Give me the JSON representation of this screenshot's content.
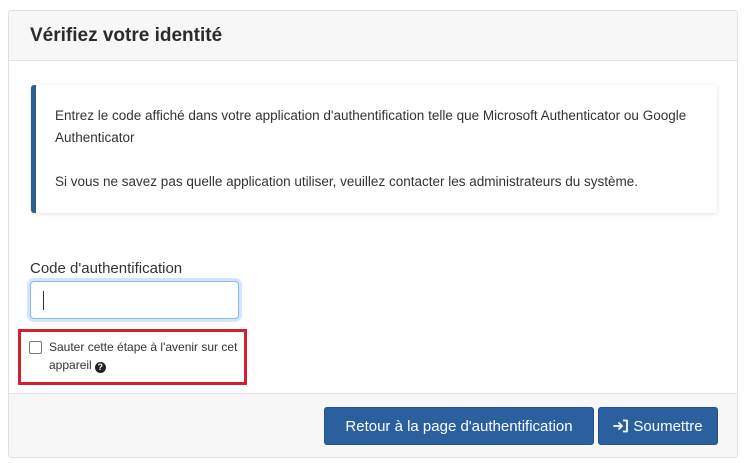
{
  "card": {
    "title": "Vérifiez votre identité"
  },
  "info": {
    "line1": "Entrez le code affiché dans votre application d'authentification telle que Microsoft Authenticator ou Google Authenticator",
    "line2": "Si vous ne savez pas quelle application utiliser, veuillez contacter les administrateurs du système."
  },
  "form": {
    "code_label": "Code d'authentification",
    "code_value": "",
    "skip_label": "Sauter cette étape à l'avenir sur cet appareil",
    "skip_checked": false
  },
  "footer": {
    "back_label": "Retour à la page d'authentification",
    "submit_label": "Soumettre"
  },
  "icons": {
    "help": "question-circle-icon",
    "submit": "sign-in-icon"
  },
  "colors": {
    "primary": "#2c5f9e",
    "info_border": "#2f5d8f",
    "highlight_border": "#d2202f"
  }
}
